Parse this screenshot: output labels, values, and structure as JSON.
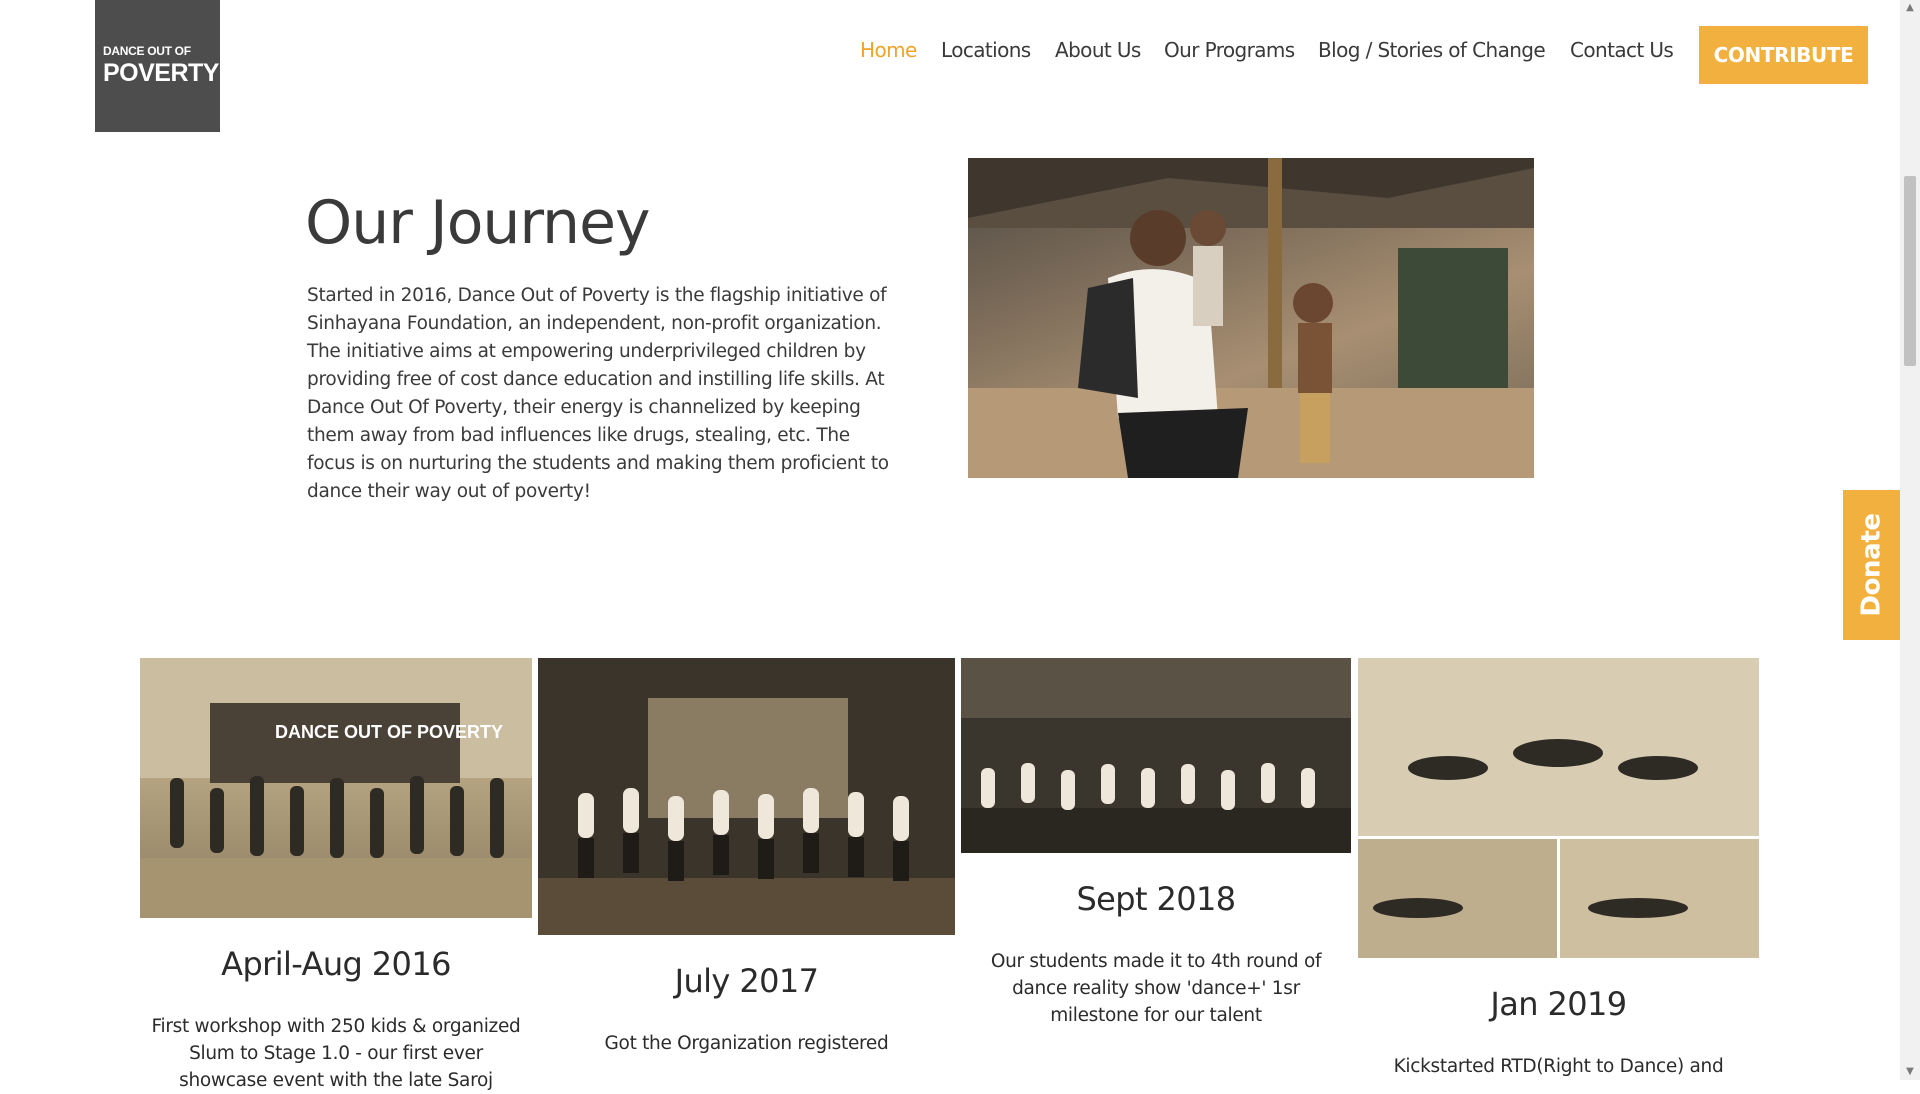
{
  "logo": {
    "line1": "DANCE OUT OF",
    "line2": "POVERTY"
  },
  "nav": {
    "items": [
      {
        "label": "Home",
        "active": true
      },
      {
        "label": "Locations"
      },
      {
        "label": "About Us"
      },
      {
        "label": "Our Programs"
      },
      {
        "label": "Blog / Stories of Change"
      },
      {
        "label": "Contact Us"
      }
    ],
    "contribute_label": "CONTRIBUTE"
  },
  "journey": {
    "title": "Our Journey",
    "text": "Started in 2016, Dance Out of Poverty is the flagship initiative of Sinhayana Foundation, an independent, non-profit organization. The initiative aims at empowering underprivileged children by providing free of cost dance education and instilling life skills. At Dance Out Of Poverty, their energy is channelized by keeping them away from bad influences like drugs, stealing, etc. The focus is on nurturing the students and making them proficient to dance their way out of poverty!"
  },
  "timeline": [
    {
      "date": "April-Aug 2016",
      "desc": "First workshop with 250 kids & organized Slum to Stage 1.0 - our first ever showcase event with the late Saroj"
    },
    {
      "date": "July 2017",
      "desc": "Got the Organization registered"
    },
    {
      "date": "Sept 2018",
      "desc": "Our students made it to 4th round of dance reality show 'dance+' 1sr milestone for our talent"
    },
    {
      "date": "Jan 2019",
      "desc": "Kickstarted RTD(Right to Dance) and"
    }
  ],
  "image_watermark": "DANCE OUT OF POVERTY",
  "donate_label": "Donate",
  "colors": {
    "accent": "#f2b13f",
    "active_nav": "#f0a32b",
    "logo_bg": "#4d4d4d",
    "text": "#2b2b2b"
  }
}
